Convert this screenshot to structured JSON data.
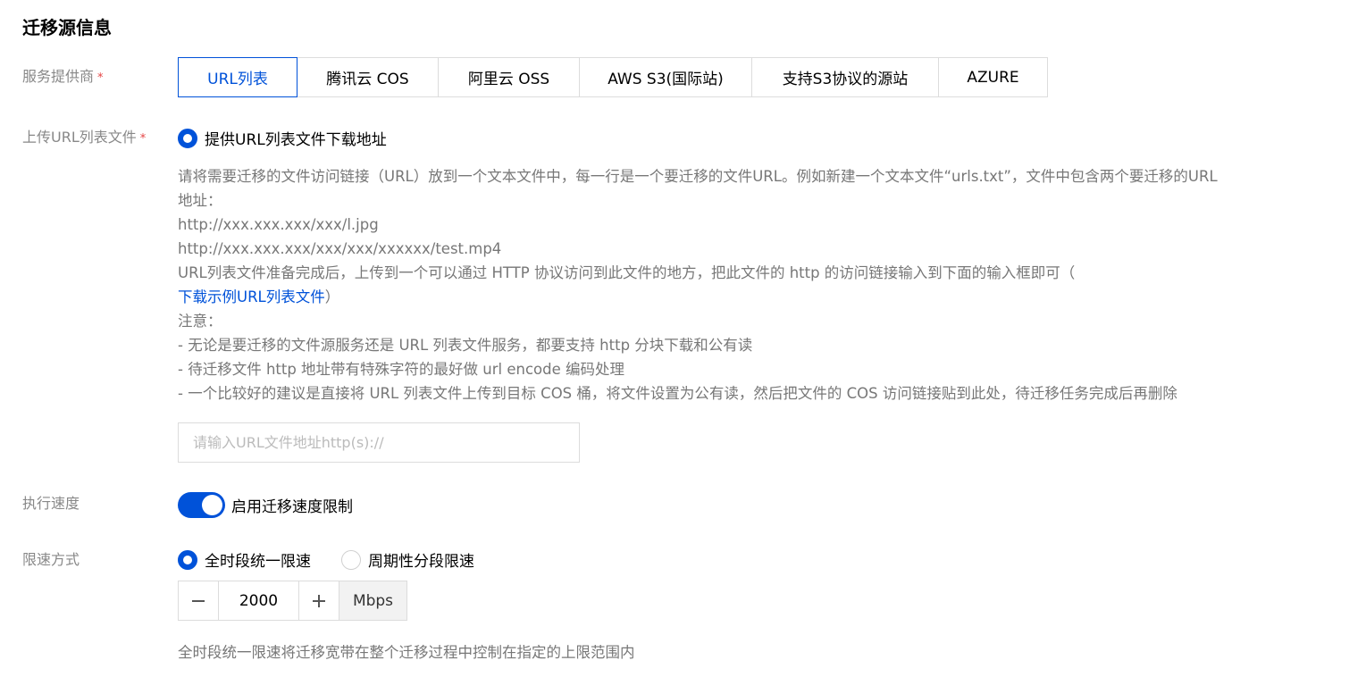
{
  "section": {
    "title": "迁移源信息"
  },
  "provider": {
    "label": "服务提供商",
    "required_mark": "*",
    "tabs": [
      {
        "label": "URL列表"
      },
      {
        "label": "腾讯云 COS"
      },
      {
        "label": "阿里云 OSS"
      },
      {
        "label": "AWS S3(国际站)"
      },
      {
        "label": "支持S3协议的源站"
      },
      {
        "label": "AZURE"
      }
    ],
    "active_index": 0
  },
  "upload": {
    "label": "上传URL列表文件",
    "required_mark": "*",
    "option_label": "提供URL列表文件下载地址",
    "help": {
      "line1": "请将需要迁移的文件访问链接（URL）放到一个文本文件中，每一行是一个要迁移的文件URL。例如新建一个文本文件“urls.txt”，文件中包含两个要迁移的URL",
      "line2": "地址：",
      "example1": "http://xxx.xxx.xxx/xxx/l.jpg",
      "example2": "http://xxx.xxx.xxx/xxx/xxx/xxxxxx/test.mp4",
      "line3": "URL列表文件准备完成后，上传到一个可以通过 HTTP 协议访问到此文件的地方，把此文件的 http 的访问链接输入到下面的输入框即可（",
      "download_link": "下载示例URL列表文件",
      "line3_end": "）",
      "note_title": "注意：",
      "note1": "- 无论是要迁移的文件源服务还是 URL 列表文件服务，都要支持 http 分块下载和公有读",
      "note2": "- 待迁移文件 http 地址带有特殊字符的最好做 url encode 编码处理",
      "note3": "- 一个比较好的建议是直接将 URL 列表文件上传到目标 COS 桶，将文件设置为公有读，然后把文件的 COS 访问链接贴到此处，待迁移任务完成后再删除"
    },
    "url_input": {
      "value": "",
      "placeholder": "请输入URL文件地址http(s)://"
    }
  },
  "speed": {
    "label": "执行速度",
    "toggle_on": true,
    "toggle_label": "启用迁移速度限制"
  },
  "limit_mode": {
    "label": "限速方式",
    "options": [
      {
        "label": "全时段统一限速",
        "checked": true
      },
      {
        "label": "周期性分段限速",
        "checked": false
      }
    ],
    "stepper": {
      "minus": "−",
      "value": "2000",
      "plus": "+",
      "unit": "Mbps"
    },
    "footnote": "全时段统一限速将迁移宽带在整个迁移过程中控制在指定的上限范围内"
  },
  "colors": {
    "accent": "#0052d9",
    "required": "#e54545",
    "label": "#888888",
    "help_text": "#777777",
    "border": "#dcdcdc"
  }
}
